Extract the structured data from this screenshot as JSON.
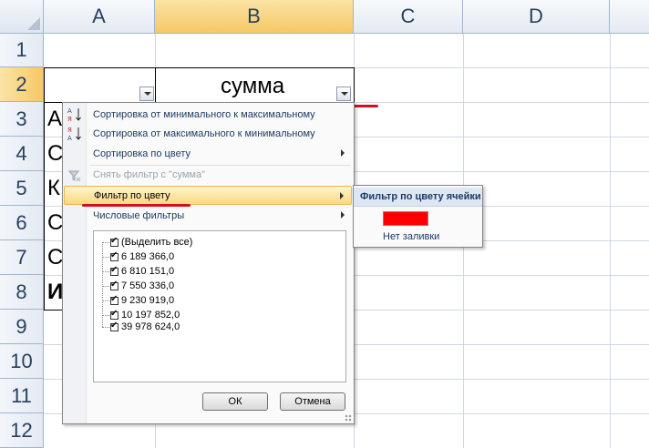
{
  "sheet": {
    "columns": [
      "A",
      "B",
      "C",
      "D"
    ],
    "rows": [
      "1",
      "2",
      "3",
      "4",
      "5",
      "6",
      "7",
      "8",
      "9",
      "10",
      "11",
      "12"
    ],
    "cells": {
      "b2": "сумма",
      "a3": "А",
      "a4": "С",
      "a5": "К",
      "a6": "С",
      "a7": "С",
      "a8": "И"
    }
  },
  "filter_menu": {
    "items": [
      {
        "label": "Сортировка от минимального к максимальному",
        "icon": "sort-ascending-icon"
      },
      {
        "label": "Сортировка от максимального к минимальному",
        "icon": "sort-descending-icon"
      },
      {
        "label": "Сортировка по цвету"
      },
      {
        "label": "Снять фильтр с \"сумма\"",
        "icon": "clear-filter-icon"
      },
      {
        "label": "Фильтр по цвету"
      },
      {
        "label": "Числовые фильтры"
      }
    ],
    "values": [
      {
        "label": "(Выделить все)",
        "checked": true
      },
      {
        "label": "6 189 366,0",
        "checked": true
      },
      {
        "label": "6 810 151,0",
        "checked": true
      },
      {
        "label": "7 550 336,0",
        "checked": true
      },
      {
        "label": "9 230 919,0",
        "checked": true
      },
      {
        "label": "10 197 852,0",
        "checked": true
      },
      {
        "label": "39 978 624,0",
        "checked": true
      }
    ],
    "ok_label": "ОК",
    "cancel_label": "Отмена"
  },
  "color_submenu": {
    "title": "Фильтр по цвету ячейки",
    "swatch_color": "#ff0000",
    "no_fill_label": "Нет заливки"
  },
  "colors": {
    "header_selected": "#f6c866",
    "highlight": "#fbd97e",
    "annotation_red": "#d3101e"
  }
}
